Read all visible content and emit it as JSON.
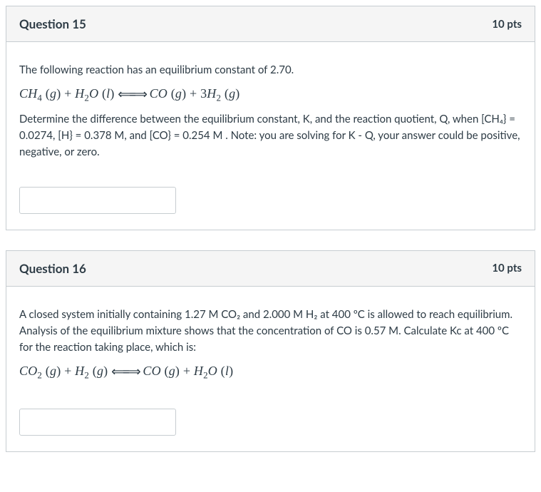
{
  "questions": [
    {
      "title": "Question 15",
      "points": "10 pts",
      "line1": "The following reaction has an equilibrium constant of 2.70.",
      "equation_html": "CH<sub>4</sub> (g) + H<sub>2</sub>O (l) ⟺ CO (g) + 3H<sub>2</sub> (g)",
      "line2": "Determine the difference between the equilibrium constant, K, and the reaction quotient, Q, when [CH₄} = 0.0274, [H} = 0.378 M, and [CO} = 0.254 M . Note: you are solving for K - Q, your answer could be positive, negative, or zero."
    },
    {
      "title": "Question 16",
      "points": "10 pts",
      "line1": "A closed system initially containing 1.27 M CO₂ and 2.000 M H₂ at 400 ºC is allowed to reach equilibrium. Analysis of the equilibrium mixture shows that the concentration of CO is 0.57 M. Calculate Kc at 400 ºC for the reaction taking place, which is:",
      "equation_html": "CO<sub>2</sub> (g) + H<sub>2</sub> (g) ⟺ CO (g) + H<sub>2</sub>O (l)"
    }
  ]
}
